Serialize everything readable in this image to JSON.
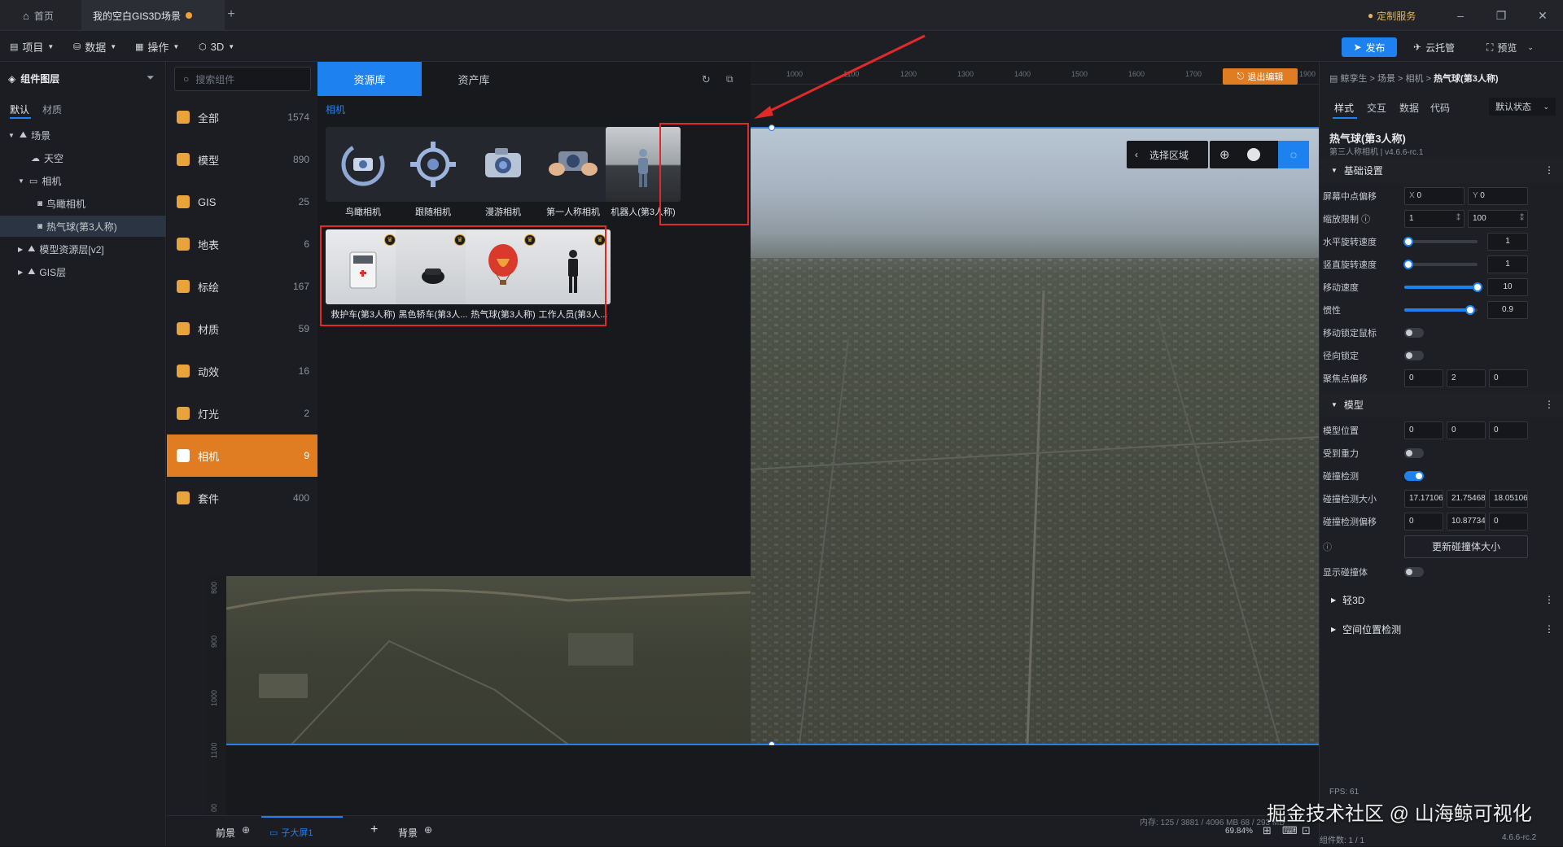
{
  "titlebar": {
    "home_tab": "首页",
    "scene_tab": "我的空白GIS3D场景",
    "custom_service": "定制服务"
  },
  "menubar": {
    "project": "项目",
    "data": "数据",
    "operation": "操作",
    "mode_3d": "3D",
    "publish": "发布",
    "cloud_host": "云托管",
    "preview": "预览"
  },
  "left": {
    "title": "组件图层",
    "tabs": [
      "默认",
      "材质"
    ],
    "tree": [
      {
        "label": "场景"
      },
      {
        "label": "天空"
      },
      {
        "label": "相机"
      },
      {
        "label": "鸟瞰相机"
      },
      {
        "label": "热气球(第3人称)"
      },
      {
        "label": "模型资源层[v2]"
      },
      {
        "label": "GIS层"
      }
    ]
  },
  "search": {
    "placeholder": "搜索组件"
  },
  "lib_tabs": {
    "resources": "资源库",
    "assets": "资产库"
  },
  "categories": [
    {
      "label": "全部",
      "count": "1574",
      "color": "#e8a33a"
    },
    {
      "label": "模型",
      "count": "890",
      "color": "#e8a33a"
    },
    {
      "label": "GIS",
      "count": "25",
      "color": "#e8a33a"
    },
    {
      "label": "地表",
      "count": "6",
      "color": "#e8a33a"
    },
    {
      "label": "标绘",
      "count": "167",
      "color": "#e8a33a"
    },
    {
      "label": "材质",
      "count": "59",
      "color": "#e8a33a"
    },
    {
      "label": "动效",
      "count": "16",
      "color": "#e8a33a"
    },
    {
      "label": "灯光",
      "count": "2",
      "color": "#e8a33a"
    },
    {
      "label": "相机",
      "count": "9",
      "color": "#ffffff"
    },
    {
      "label": "套件",
      "count": "400",
      "color": "#e8a33a"
    }
  ],
  "resources": {
    "section": "相机",
    "row1": [
      "鸟瞰相机",
      "跟随相机",
      "漫游相机",
      "第一人称相机",
      "机器人(第3人称)"
    ],
    "row2": [
      "救护车(第3人称)",
      "黑色轿车(第3人...",
      "热气球(第3人称)",
      "工作人员(第3人..."
    ]
  },
  "viewport": {
    "exit_edit": "退出编辑",
    "select_area": "选择区域",
    "ruler_top": [
      "1000",
      "1100",
      "1200",
      "1300",
      "1400",
      "1500",
      "1600",
      "1700",
      "1800",
      "1900"
    ],
    "ruler_left": [
      "800",
      "900",
      "1000",
      "1100",
      "00"
    ]
  },
  "right": {
    "breadcrumb": "鲸孪生 > 场景 > 相机 > ",
    "breadcrumb_current": "热气球(第3人称)",
    "tabs": [
      "样式",
      "交互",
      "数据",
      "代码"
    ],
    "state": "默认状态",
    "name": "热气球(第3人称)",
    "subtitle": "第三人称相机 | v4.6.6-rc.1",
    "basic_section": "基础设置",
    "screen_offset_label": "屏幕中点偏移",
    "screen_offset": {
      "x_prefix": "X",
      "x": "0",
      "y_prefix": "Y",
      "y": "0"
    },
    "zoom_label": "缩放限制",
    "zoom": {
      "min": "1",
      "max": "100"
    },
    "h_rot_label": "水平旋转速度",
    "h_rot": {
      "value": "1",
      "level": 0.05
    },
    "v_rot_label": "竖直旋转速度",
    "v_rot": {
      "value": "1",
      "level": 0.05
    },
    "move_label": "移动速度",
    "move": {
      "value": "10",
      "level": 1.0
    },
    "inertia_label": "惯性",
    "inertia": {
      "value": "0.9",
      "level": 0.9
    },
    "lock_mouse_label": "移动锁定鼠标",
    "radial_lock_label": "径向锁定",
    "focus_offset_label": "聚焦点偏移",
    "focus_offset": [
      "0",
      "2",
      "0"
    ],
    "model_section": "模型",
    "model_pos_label": "模型位置",
    "model_pos": [
      "0",
      "0",
      "0"
    ],
    "gravity_label": "受到重力",
    "collision_label": "碰撞检测",
    "collision_size_label": "碰撞检测大小",
    "collision_size": [
      "17.1710653",
      "21.754685",
      "18.051065"
    ],
    "collision_offset_label": "碰撞检测偏移",
    "collision_offset": [
      "0",
      "10.877342",
      "0"
    ],
    "update_collision": "更新碰撞体大小",
    "show_collider_label": "显示碰撞体",
    "light3d_section": "轻3D",
    "spatial_section": "空间位置检测"
  },
  "bottom": {
    "foreground": "前景",
    "sub_screen": "子大屏1",
    "background": "背景",
    "zoom": "69.84%",
    "memory": "内存: 125 / 3881 / 4096 MB 68 / 293 MB",
    "fps": "FPS: 61",
    "component_count": "组件数: 1 / 1",
    "version": "4.6.6-rc.2"
  },
  "watermark": "掘金技术社区 @ 山海鲸可视化"
}
